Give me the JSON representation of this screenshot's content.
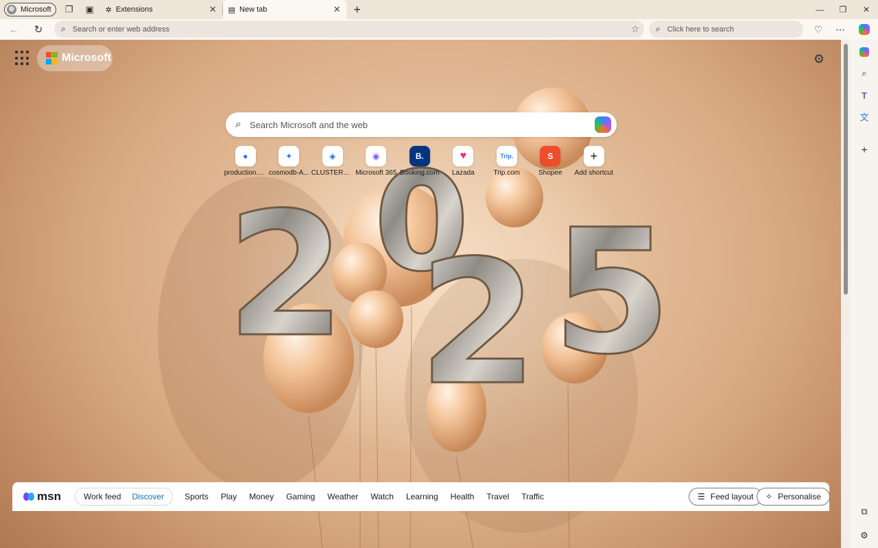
{
  "profile": {
    "label": "Microsoft"
  },
  "tabs": [
    {
      "title": "Extensions",
      "icon": "puzzle-icon"
    },
    {
      "title": "New tab",
      "icon": "newtab-icon"
    }
  ],
  "addressbar": {
    "placeholder": "Search or enter web address"
  },
  "toolbar_search": {
    "placeholder": "Click here to search"
  },
  "brand": {
    "label": "Microsoft",
    "logo_colors": [
      "#f25022",
      "#7fba00",
      "#00a4ef",
      "#ffb900"
    ]
  },
  "page_search": {
    "placeholder": "Search Microsoft and the web"
  },
  "shortcuts": [
    {
      "label": "production.pl...",
      "glyph": "●",
      "color": "#3b6df0"
    },
    {
      "label": "cosmodb-A...",
      "glyph": "✦",
      "color": "#3b6df0"
    },
    {
      "label": "CLUSTERED ...",
      "glyph": "◈",
      "color": "#1f6fd0"
    },
    {
      "label": "Microsoft 365",
      "glyph": "◉",
      "color": "#7b5cff"
    },
    {
      "label": "Booking.com",
      "glyph": "B.",
      "color": "#003580"
    },
    {
      "label": "Lazada",
      "glyph": "♥",
      "color": "#f0306a"
    },
    {
      "label": "Trip.com",
      "glyph": "Trip.",
      "color": "#2f7cf6"
    },
    {
      "label": "Shopee",
      "glyph": "S",
      "color": "#ee4d2d"
    },
    {
      "label": "Add shortcut",
      "glyph": "+",
      "color": "#333333"
    }
  ],
  "feed": {
    "logo_text": "msn",
    "segments": [
      "Work feed",
      "Discover"
    ],
    "active_segment": "Discover",
    "categories": [
      "Sports",
      "Play",
      "Money",
      "Gaming",
      "Weather",
      "Watch",
      "Learning",
      "Health",
      "Travel",
      "Traffic"
    ],
    "feed_layout_label": "Feed layout",
    "personalise_label": "Personalise"
  },
  "sidebar_icons": [
    "copilot-icon",
    "search-icon",
    "teams-icon",
    "translate-icon",
    "add-icon",
    "screenshot-icon",
    "settings-icon"
  ]
}
